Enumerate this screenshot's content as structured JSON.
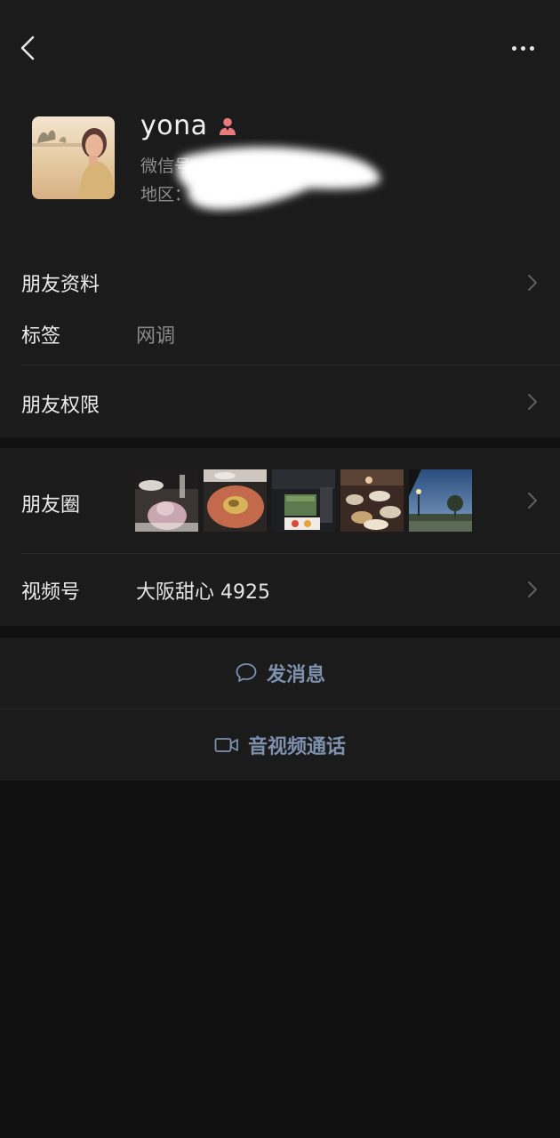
{
  "topbar": {
    "back_icon": "chevron-left-icon",
    "more_icon": "more-dots-icon"
  },
  "profile": {
    "name": "yona",
    "gender_icon": "female-icon",
    "wechat_id": "微信号：",
    "region": "地区："
  },
  "rows": {
    "friend_info": "朋友资料",
    "tags_label": "标签",
    "tags_value": "网调",
    "permissions": "朋友权限",
    "moments": "朋友圈",
    "channels_label": "视频号",
    "channels_value": "大阪甜心 4925"
  },
  "actions": {
    "message": "发消息",
    "call": "音视频通话"
  },
  "colors": {
    "background": "#111111",
    "panel": "#1b1b1b",
    "action_text": "#7d90ae",
    "gender_icon": "#e8797c"
  }
}
